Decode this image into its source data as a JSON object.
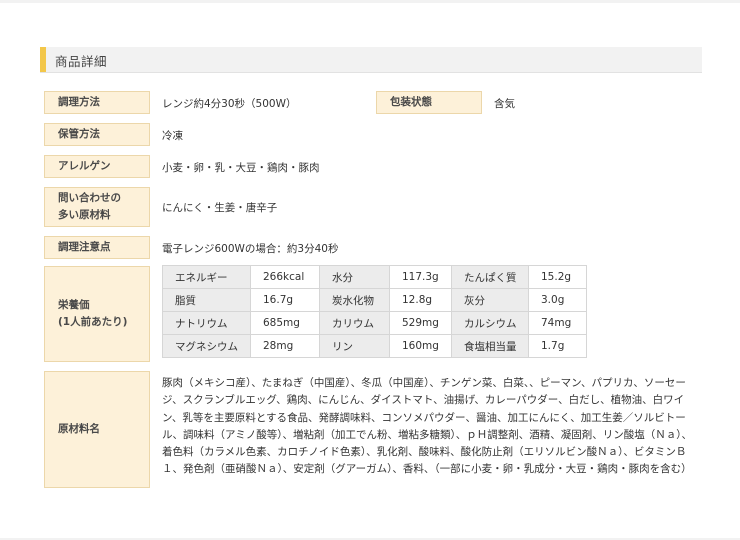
{
  "section_title": "商品詳細",
  "rows": {
    "cooking": {
      "label": "調理方法",
      "value": "レンジ約4分30秒（500W）"
    },
    "package": {
      "label": "包装状態",
      "value": "含気"
    },
    "storage": {
      "label": "保管方法",
      "value": "冷凍"
    },
    "allergen": {
      "label": "アレルゲン",
      "value": "小麦・卵・乳・大豆・鶏肉・豚肉"
    },
    "inquiry": {
      "label_line1": "問い合わせの",
      "label_line2": "多い原材料",
      "value": "にんにく・生姜・唐辛子"
    },
    "caution": {
      "label": "調理注意点",
      "value": "電子レンジ600Wの場合：約3分40秒"
    },
    "nutrition": {
      "label_line1": "栄養価",
      "label_line2": "(1人前あたり)"
    },
    "raw": {
      "label": "原材料名",
      "value": "豚肉（メキシコ産）、たまねぎ（中国産）、冬瓜（中国産）、チンゲン菜、白菜、、ピーマン、パプリカ、ソーセージ、スクランブルエッグ、鶏肉、にんじん、ダイストマト、油揚げ、カレーパウダー、白だし、植物油、白ワイン、乳等を主要原料とする食品、発酵調味料、コンソメパウダー、醤油、加工にんにく、加工生姜／ソルビトール、調味料（アミノ酸等）、増粘剤（加工でん粉、増粘多糖類）、ｐＨ調整剤、酒精、凝固剤、リン酸塩（Ｎａ）、着色料（カラメル色素、カロチノイド色素）、乳化剤、酸味料、酸化防止剤（エリソルビン酸Ｎａ）、ビタミンＢ１、発色剤（亜硝酸Ｎａ）、安定剤（グアーガム）、香料、（一部に小麦・卵・乳成分・大豆・鶏肉・豚肉を含む）"
    }
  },
  "nutrition_table": [
    [
      {
        "k": "エネルギー",
        "v": "266kcal"
      },
      {
        "k": "水分",
        "v": "117.3g"
      },
      {
        "k": "たんぱく質",
        "v": "15.2g"
      }
    ],
    [
      {
        "k": "脂質",
        "v": "16.7g"
      },
      {
        "k": "炭水化物",
        "v": "12.8g"
      },
      {
        "k": "灰分",
        "v": "3.0g"
      }
    ],
    [
      {
        "k": "ナトリウム",
        "v": "685mg"
      },
      {
        "k": "カリウム",
        "v": "529mg"
      },
      {
        "k": "カルシウム",
        "v": "74mg"
      }
    ],
    [
      {
        "k": "マグネシウム",
        "v": "28mg"
      },
      {
        "k": "リン",
        "v": "160mg"
      },
      {
        "k": "食塩相当量",
        "v": "1.7g"
      }
    ]
  ]
}
